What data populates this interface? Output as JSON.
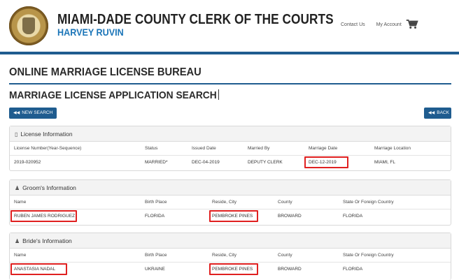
{
  "header": {
    "org_title": "MIAMI-DADE COUNTY CLERK OF THE COURTS",
    "org_subtitle": "HARVEY RUVIN",
    "seal_text": "CIRCUIT AND COUNTY COURTS",
    "links": {
      "contact": "Contact Us",
      "account": "My Account"
    },
    "cart_icon": "shopping-cart-icon",
    "accent_color": "#1f5c8f"
  },
  "page": {
    "title": "ONLINE MARRIAGE LICENSE BUREAU",
    "subtitle": "MARRIAGE LICENSE APPLICATION SEARCH"
  },
  "buttons": {
    "new_search": "NEW SEARCH",
    "back": "BACK",
    "icon": "double-chevron-left-icon"
  },
  "license": {
    "heading": "License Information",
    "columns": [
      "License Number(Year-Sequence)",
      "Status",
      "Issued Date",
      "Married By",
      "Marriage Date",
      "Marriage Location"
    ],
    "row": [
      "2019-020952",
      "MARRIED*",
      "DEC-04-2019",
      "DEPUTY CLERK",
      "DEC-12-2019",
      "MIAMI, FL"
    ]
  },
  "groom": {
    "heading": "Groom's Information",
    "columns": [
      "Name",
      "Birth Place",
      "Reside, City",
      "County",
      "State Or Foreign Country"
    ],
    "row": [
      "RUBEN JAMES RODRIGUEZ",
      "FLORIDA",
      "PEMBROKE PINES",
      "BROWARD",
      "FLORIDA"
    ]
  },
  "bride": {
    "heading": "Bride's Information",
    "columns": [
      "Name",
      "Birth Place",
      "Reside, City",
      "County",
      "State Or Foreign Country"
    ],
    "row": [
      "ANASTASIA NADAL",
      "UKRAINE",
      "PEMBROKE PINES",
      "BROWARD",
      "FLORIDA"
    ]
  },
  "highlight_color": "#e02020"
}
